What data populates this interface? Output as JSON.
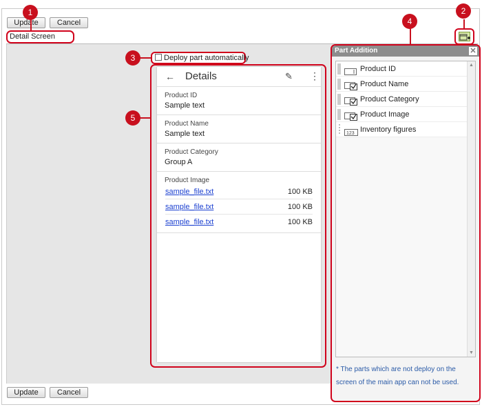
{
  "toolbar_top": {
    "update": "Update",
    "cancel": "Cancel"
  },
  "toolbar_bottom": {
    "update": "Update",
    "cancel": "Cancel"
  },
  "screen_title": "Detail Screen",
  "deploy_label": "Deploy part automatically",
  "callouts": [
    "1",
    "2",
    "3",
    "4",
    "5"
  ],
  "phone": {
    "title": "Details",
    "fields": [
      {
        "label": "Product ID",
        "value": "Sample text"
      },
      {
        "label": "Product Name",
        "value": "Sample text"
      },
      {
        "label": "Product Category",
        "value": "Group A"
      }
    ],
    "image_label": "Product Image",
    "files": [
      {
        "name": "sample_file.txt",
        "size": "100 KB"
      },
      {
        "name": "sample_file.txt",
        "size": "100 KB"
      },
      {
        "name": "sample_file.txt",
        "size": "100 KB"
      }
    ]
  },
  "part_panel": {
    "title": "Part Addition",
    "items": [
      {
        "name": "Product ID",
        "icon": "text-field-icon"
      },
      {
        "name": "Product Name",
        "icon": "checkbox-field-icon"
      },
      {
        "name": "Product Category",
        "icon": "checkbox-field-icon"
      },
      {
        "name": "Product Image",
        "icon": "checkbox-field-icon"
      },
      {
        "name": "Inventory figures",
        "icon": "number-field-icon"
      }
    ],
    "note": "* The parts which are not deploy on the screen of the main app can not be used."
  },
  "colors": {
    "accent": "#c8101e",
    "link": "#1a3fd0",
    "note": "#2a5aa7"
  }
}
